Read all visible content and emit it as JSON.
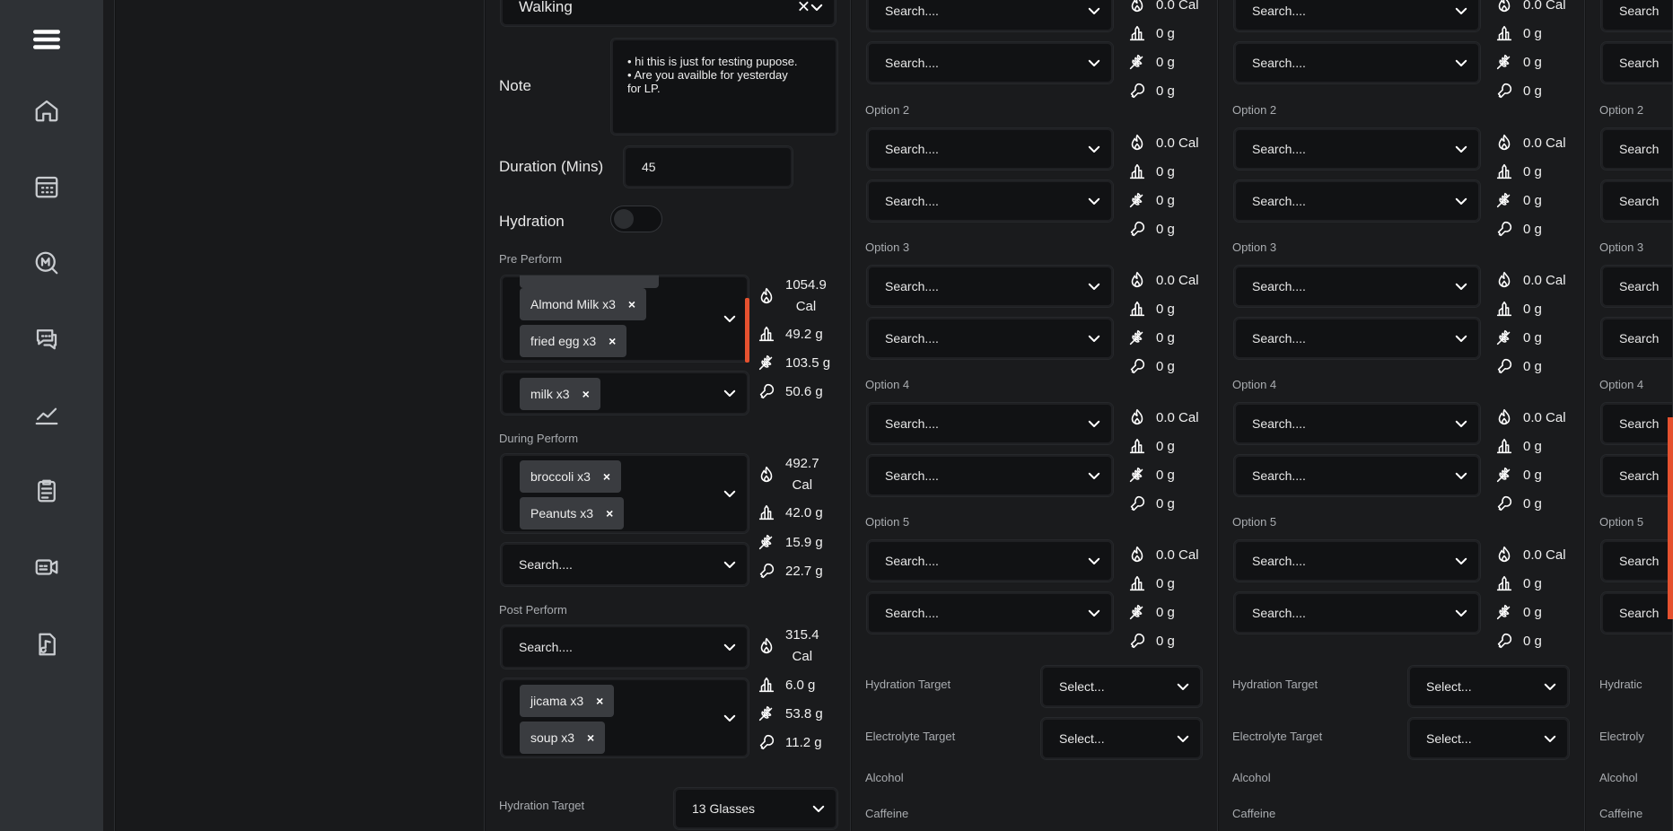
{
  "nav": {
    "items": [
      {
        "icon": "menu-icon"
      },
      {
        "icon": "home-icon"
      },
      {
        "icon": "calendar-icon"
      },
      {
        "icon": "chat-m-icon"
      },
      {
        "icon": "messages-icon"
      },
      {
        "icon": "chart-icon"
      },
      {
        "icon": "clipboard-icon"
      },
      {
        "icon": "video-icon"
      },
      {
        "icon": "music-file-icon"
      }
    ]
  },
  "activity": {
    "value": "Walking"
  },
  "note": {
    "label": "Note",
    "lines": [
      "• hi this is just for testing pupose.",
      "•  Are you availble for yesterday",
      "for LP."
    ]
  },
  "duration": {
    "label": "Duration (Mins)",
    "value": "45"
  },
  "hydration": {
    "label": "Hydration",
    "on": false
  },
  "pre": {
    "label": "Pre Perform",
    "sel1_chips": [
      "Almond Milk x3",
      "fried egg x3"
    ],
    "sel2_chips": [
      "milk x3"
    ],
    "cal": "1054.9",
    "cal_unit": "Cal",
    "protein": "49.2 g",
    "carb": "103.5 g",
    "fat": "50.6 g"
  },
  "during": {
    "label": "During Perform",
    "sel1_chips": [
      "broccoli x3",
      "Peanuts x3"
    ],
    "sel2": "Search....",
    "cal": "492.7",
    "cal_unit": "Cal",
    "protein": "42.0 g",
    "carb": "15.9 g",
    "fat": "22.7 g"
  },
  "post": {
    "label": "Post Perform",
    "sel1": "Search....",
    "sel2_chips": [
      "jicama x3",
      "soup x3"
    ],
    "cal": "315.4",
    "cal_unit": "Cal",
    "protein": "6.0 g",
    "carb": "53.8 g",
    "fat": "11.2 g"
  },
  "hydration_target": {
    "label": "Hydration Target",
    "value": "13 Glasses"
  },
  "options": {
    "labels": [
      "Option 2",
      "Option 3",
      "Option 4",
      "Option 5"
    ],
    "search": "Search....",
    "cal": "0.0 Cal",
    "zero": "0 g",
    "top_cal": "0.0 Cal"
  },
  "targets": {
    "hydration": "Hydration Target",
    "electrolyte": "Electrolyte Target",
    "select": "Select...",
    "alcohol": "Alcohol",
    "caffeine": "Caffeine"
  },
  "partial": {
    "search": "Search",
    "opt2": "Option 2",
    "opt3": "Option 3",
    "opt4": "Option 4",
    "opt5": "Option 5",
    "hyd": "Hydratic",
    "elec": "Electroly",
    "alcohol": "Alcohol",
    "caffeine": "Caffeine"
  },
  "colors": {
    "accent": "#e5512f",
    "bg": "#1a1b1d",
    "rail": "#2e3135"
  }
}
